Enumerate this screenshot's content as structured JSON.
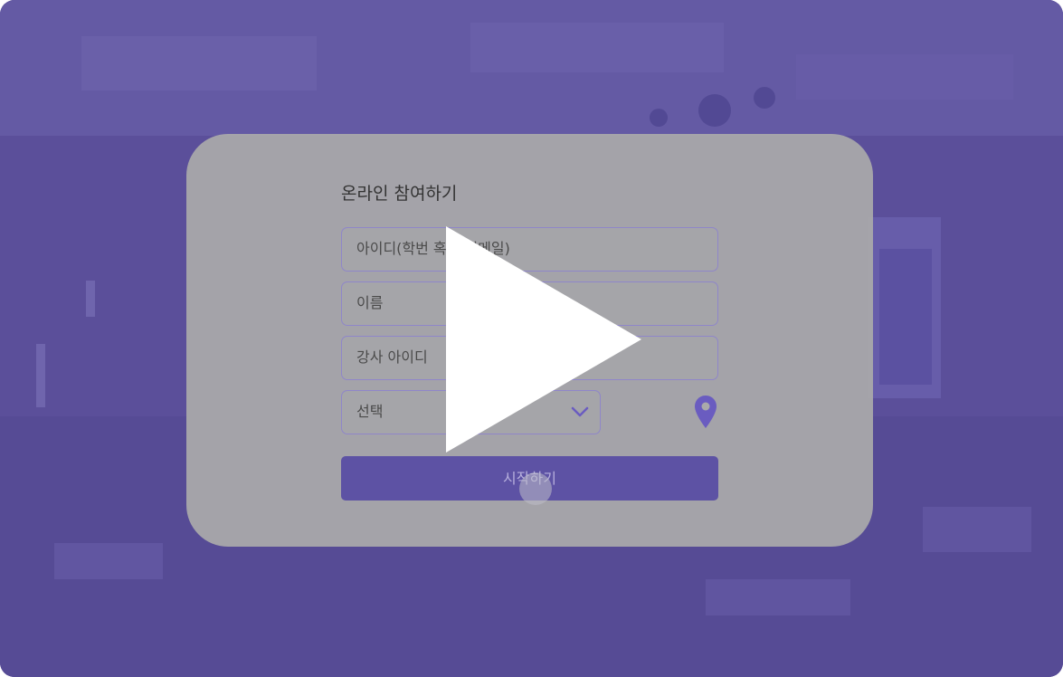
{
  "form": {
    "title": "온라인 참여하기",
    "id_placeholder": "아이디(학번 혹은 이메일)",
    "name_placeholder": "이름",
    "teacher_placeholder": "강사 아이디",
    "select_value": "선택",
    "start_label": "시작하기"
  },
  "icons": {
    "location": "location-pin-icon",
    "dropdown": "chevron-down-icon",
    "play": "play-icon"
  },
  "colors": {
    "background": "#5b4f9a",
    "accent": "#5d52a4",
    "pin": "#6a5cc0",
    "card": "#aaaaaa"
  }
}
